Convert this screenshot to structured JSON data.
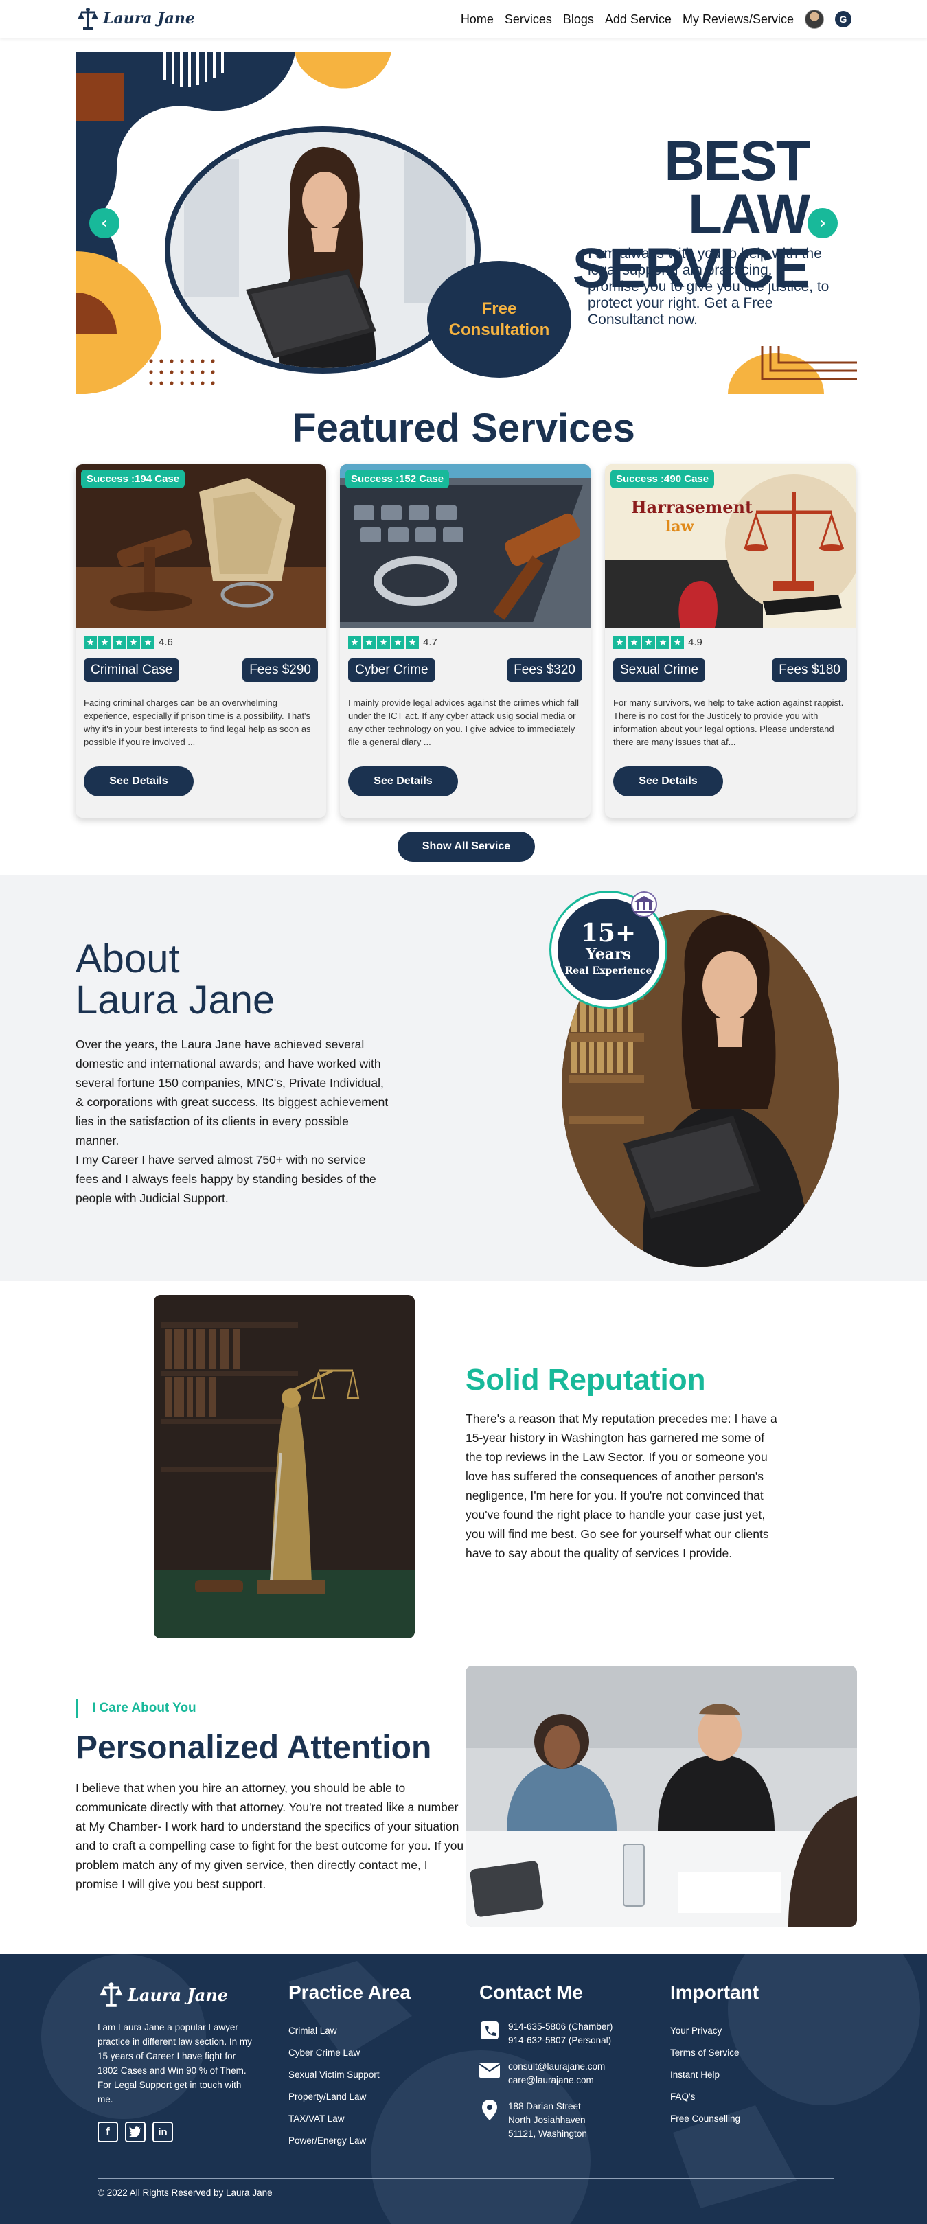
{
  "nav": {
    "logo_text": "Laura Jane",
    "links": [
      "Home",
      "Services",
      "Blogs",
      "Add Service",
      "My Reviews/Service"
    ],
    "user_badge": "G"
  },
  "hero": {
    "title_line1": "BEST LAW",
    "title_line2": "SERVICE",
    "text": "I am always with you to help with the legal support I am practicing. I promise you to give you the justice, to protect your right. Get a Free Consultanct now.",
    "badge_line1": "Free",
    "badge_line2": "Consultation",
    "prev_arrow": "‹",
    "next_arrow": "›"
  },
  "featured": {
    "title": "Featured Services",
    "cards": [
      {
        "badge": "Success :194 Case",
        "rating": "4.6",
        "category": "Criminal Case",
        "fee": "Fees $290",
        "desc": "Facing criminal charges can be an overwhelming experience, especially if prison time is a possibility. That's why it's in your best interests to find legal help as soon as possible if you're involved ...",
        "button": "See Details"
      },
      {
        "badge": "Success :152 Case",
        "rating": "4.7",
        "category": "Cyber Crime",
        "fee": "Fees $320",
        "desc": "I mainly provide legal advices against the crimes which fall under the ICT act. If any cyber attack usig social media or any other technology on you. I give advice to immediately file a general diary ...",
        "button": "See Details"
      },
      {
        "badge": "Success :490 Case",
        "rating": "4.9",
        "category": "Sexual Crime",
        "fee": "Fees $180",
        "desc": "For many survivors, we help to take action against rappist. There is no cost for the Justicely to provide you with information about your legal options. Please understand there are many issues that af...",
        "button": "See Details",
        "image_text_1": "Harrasement",
        "image_text_2": "law"
      }
    ],
    "show_all": "Show All Service"
  },
  "about": {
    "title_line1": "About",
    "title_line2": "Laura Jane",
    "text": "Over the years, the Laura Jane have achieved several domestic and international awards; and have worked with several fortune 150 companies, MNC's, Private Individual, & corporations with great success. Its biggest achievement lies in the satisfaction of its clients in every possible manner.",
    "text2": "I my Career I have served almost 750+ with no service fees and I always feels happy by standing besides of the people with Judicial Support.",
    "badge_num": "15+",
    "badge_years": "Years",
    "badge_sub": "Real Experience"
  },
  "reputation": {
    "title": "Solid Reputation",
    "text": "There's a reason that My reputation precedes me: I have a 15-year history in Washington has garnered me some of the top reviews in the Law Sector. If you or someone you love has suffered the consequences of another person's negligence, I'm here for you. If you're not convinced that you've found the right place to handle your case just yet, you will find me best. Go see for yourself what our clients have to say about the quality of services I provide."
  },
  "personal": {
    "tag": "I Care About You",
    "title": "Personalized Attention",
    "text": "I believe that when you hire an attorney, you should be able to communicate directly with that attorney. You're not treated like a number at My Chamber- I work hard to understand the specifics of your situation and to craft a compelling case to fight for the best outcome for you. If you problem match any of my given service, then directly contact me, I promise I will give you best support."
  },
  "footer": {
    "logo_text": "Laura Jane",
    "about": "I am Laura Jane a popular Lawyer practice in different law section. In my 15 years of Career I have fight for 1802 Cases and Win 90 % of Them. For Legal Support get in touch with me.",
    "practice_title": "Practice Area",
    "practice": [
      "Crimial Law",
      "Cyber Crime Law",
      "Sexual Victim Support",
      "Property/Land Law",
      "TAX/VAT Law",
      "Power/Energy Law"
    ],
    "contact_title": "Contact Me",
    "phone1": "914-635-5806 (Chamber)",
    "phone2": "914-632-5807 (Personal)",
    "email1": "consult@laurajane.com",
    "email2": "care@laurajane.com",
    "addr1": "188 Darian Street",
    "addr2": "North Josiahhaven",
    "addr3": "51121, Washington",
    "important_title": "Important",
    "important": [
      "Your Privacy",
      "Terms of Service",
      "Instant Help",
      "FAQ's",
      "Free Counselling"
    ],
    "copyright": "© 2022 All Rights Reserved by Laura Jane"
  },
  "colors": {
    "navy": "#1b3250",
    "teal": "#18b99a",
    "orange": "#f6b340",
    "brown": "#8b3e1a"
  }
}
